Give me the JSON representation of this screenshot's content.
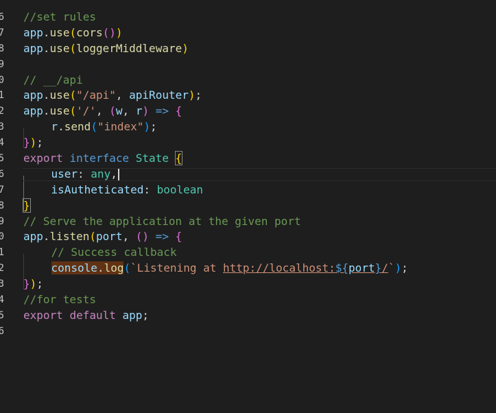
{
  "editor": {
    "line_numbers": [
      "6",
      "7",
      "8",
      "9",
      "0",
      "1",
      "2",
      "3",
      "4",
      "5",
      "6",
      "7",
      "8",
      "9",
      "0",
      "1",
      "2",
      "3",
      "4",
      "5",
      "6"
    ],
    "code_tokens": {
      "l1_comment": "//set rules",
      "l2_app": "app",
      "l2_dot": ".",
      "l2_use": "use",
      "l2_open": "(",
      "l2_cors": "cors",
      "l2_inner": "()",
      "l2_close": ")",
      "l3_app": "app",
      "l3_dot": ".",
      "l3_use": "use",
      "l3_open": "(",
      "l3_arg": "loggerMiddleware",
      "l3_close": ")",
      "l5_comment": "// __/api",
      "l6_app": "app",
      "l6_dot": ".",
      "l6_use": "use",
      "l6_open": "(",
      "l6_str": "\"/api\"",
      "l6_comma": ", ",
      "l6_router": "apiRouter",
      "l6_close": ")",
      "l6_semi": ";",
      "l7_app": "app",
      "l7_dot": ".",
      "l7_use": "use",
      "l7_open": "(",
      "l7_str": "'/'",
      "l7_comma": ", ",
      "l7_popen": "(",
      "l7_w": "w",
      "l7_comma2": ", ",
      "l7_r": "r",
      "l7_pclose": ")",
      "l7_arrow": " => ",
      "l7_brace": "{",
      "l8_r": "r",
      "l8_dot": ".",
      "l8_send": "send",
      "l8_open": "(",
      "l8_str": "\"index\"",
      "l8_close": ")",
      "l8_semi": ";",
      "l9_brace": "}",
      "l9_close": ")",
      "l9_semi": ";",
      "l10_export": "export",
      "l10_interface": "interface",
      "l10_name": "State",
      "l10_brace": "{",
      "l11_prop": "user",
      "l11_colon": ": ",
      "l11_type": "any",
      "l11_comma": ",",
      "l12_prop": "isAutheticated",
      "l12_colon": ": ",
      "l12_type": "boolean",
      "l13_brace": "}",
      "l14_comment": "// Serve the application at the given port",
      "l15_app": "app",
      "l15_dot": ".",
      "l15_listen": "listen",
      "l15_open": "(",
      "l15_port": "port",
      "l15_comma": ", ",
      "l15_parens": "()",
      "l15_arrow": " => ",
      "l15_brace": "{",
      "l16_comment": "// Success callback",
      "l17_console": "console",
      "l17_dot": ".",
      "l17_log": "log",
      "l17_open": "(",
      "l17_tpl_start": "`Listening at ",
      "l17_url": "http://localhost:",
      "l17_interp_open": "${",
      "l17_port": "port",
      "l17_interp_close": "}",
      "l17_url_end": "/",
      "l17_tpl_end": "`",
      "l17_close": ")",
      "l17_semi": ";",
      "l18_brace": "}",
      "l18_close": ")",
      "l18_semi": ";",
      "l19_comment": "//for tests",
      "l20_export": "export",
      "l20_default": "default",
      "l20_app": "app",
      "l20_semi": ";"
    }
  },
  "colors": {
    "background": "#1e1e1e",
    "comment": "#6a9955",
    "variable": "#9cdcfe",
    "function": "#dcdcaa",
    "string": "#ce9178",
    "keyword_control": "#c586c0",
    "keyword": "#569cd6",
    "type": "#4ec9b0",
    "bracket_level_1": "#ffd700",
    "bracket_level_2": "#da70d6",
    "bracket_level_3": "#179fff"
  }
}
